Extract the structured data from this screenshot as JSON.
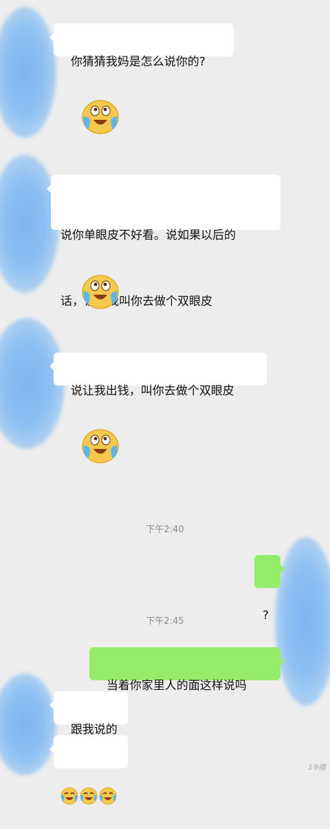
{
  "messages": {
    "m1": "你猜猜我妈是怎么说你的?",
    "m2_line1": "说你单眼皮不好看。说如果以后的",
    "m2_line2": "话，让让我叫你去做个双眼皮",
    "m3": "说让我出钱，叫你去做个双眼皮",
    "m4": "?",
    "m5": "当着你家里人的面这样说吗",
    "m6": "跟我说的"
  },
  "times": {
    "t1": "下午2:40",
    "t2": "下午2:45"
  },
  "stickers": [
    "crying-laughing-emoji",
    "crying-laughing-emoji",
    "crying-laughing-emoji"
  ],
  "colors": {
    "background": "#ededed",
    "incoming_bubble": "#ffffff",
    "outgoing_bubble": "#95ec69",
    "avatar_blur": "#8cc0f3"
  },
  "watermark": "19楼"
}
